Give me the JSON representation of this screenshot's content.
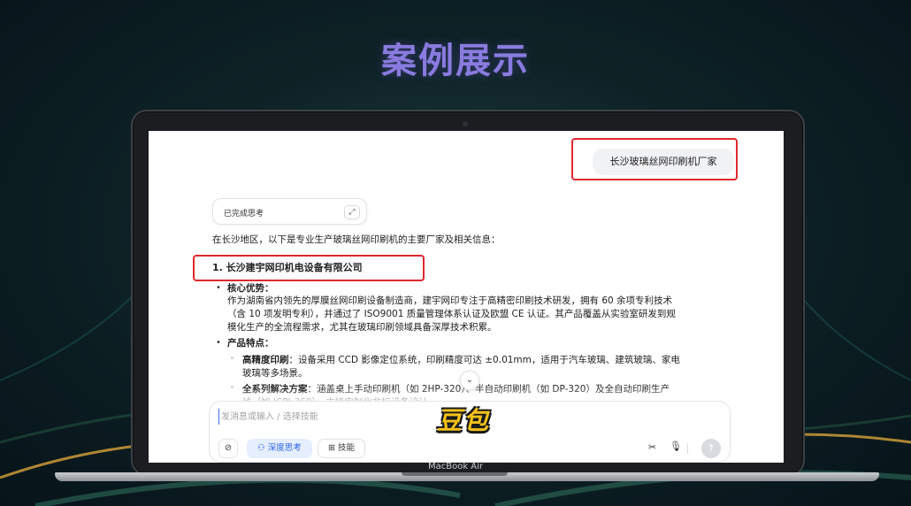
{
  "page": {
    "title": "案例展示",
    "watermark": "豆包",
    "device_label": "MacBook Air"
  },
  "chat": {
    "user_message": "长沙玻璃丝网印刷机厂家",
    "thinking_status": "已完成思考",
    "intro": "在长沙地区，以下是专业生产玻璃丝网印刷机的主要厂家及相关信息：",
    "company": {
      "title": "1. 长沙建宇网印机电设备有限公司",
      "core_label": "核心优势",
      "core_lines": [
        "作为湖南省内领先的厚膜丝网印刷设备制造商，建宇网印专注于高精密印刷技术研发，拥有 60 余项专利技术",
        "（含 10 项发明专利），并通过了 ISO9001 质量管理体系认证及欧盟 CE 认证。其产品覆盖从实验室研发到规",
        "模化生产的全流程需求，尤其在玻璃印刷领域具备深厚技术积累。"
      ],
      "features_label": "产品特点",
      "features": [
        {
          "label": "高精度印刷",
          "lines": [
            "设备采用 CCD 影像定位系统，印刷精度可达 ±0.01mm，适用于汽车玻璃、建筑玻璃、家电",
            "玻璃等多场景。"
          ]
        },
        {
          "label": "全系列解决方案",
          "lines": [
            "涵盖桌上手动印刷机（如 2HP-320）、半自动印刷机（如 DP-320）及全自动印刷生产",
            "线（如 JCPI-360），支持定制化非标设备设计。"
          ]
        }
      ]
    }
  },
  "composer": {
    "placeholder": "发消息或输入 / 选择技能",
    "deep_think_label": "深度思考",
    "skills_label": "技能"
  },
  "icons": {
    "attach": "paperclip-icon",
    "deep_think": "deep-think-icon",
    "skills": "grid-icon",
    "expand": "expand-icon",
    "scroll": "chevron-down-icon",
    "scissors": "scissors-icon",
    "mic": "microphone-icon",
    "send": "arrow-up-icon"
  },
  "colors": {
    "title": "#8a7be0",
    "highlight": "#e0282e",
    "accent": "#2e63e8",
    "watermark": "#f6c21a"
  }
}
